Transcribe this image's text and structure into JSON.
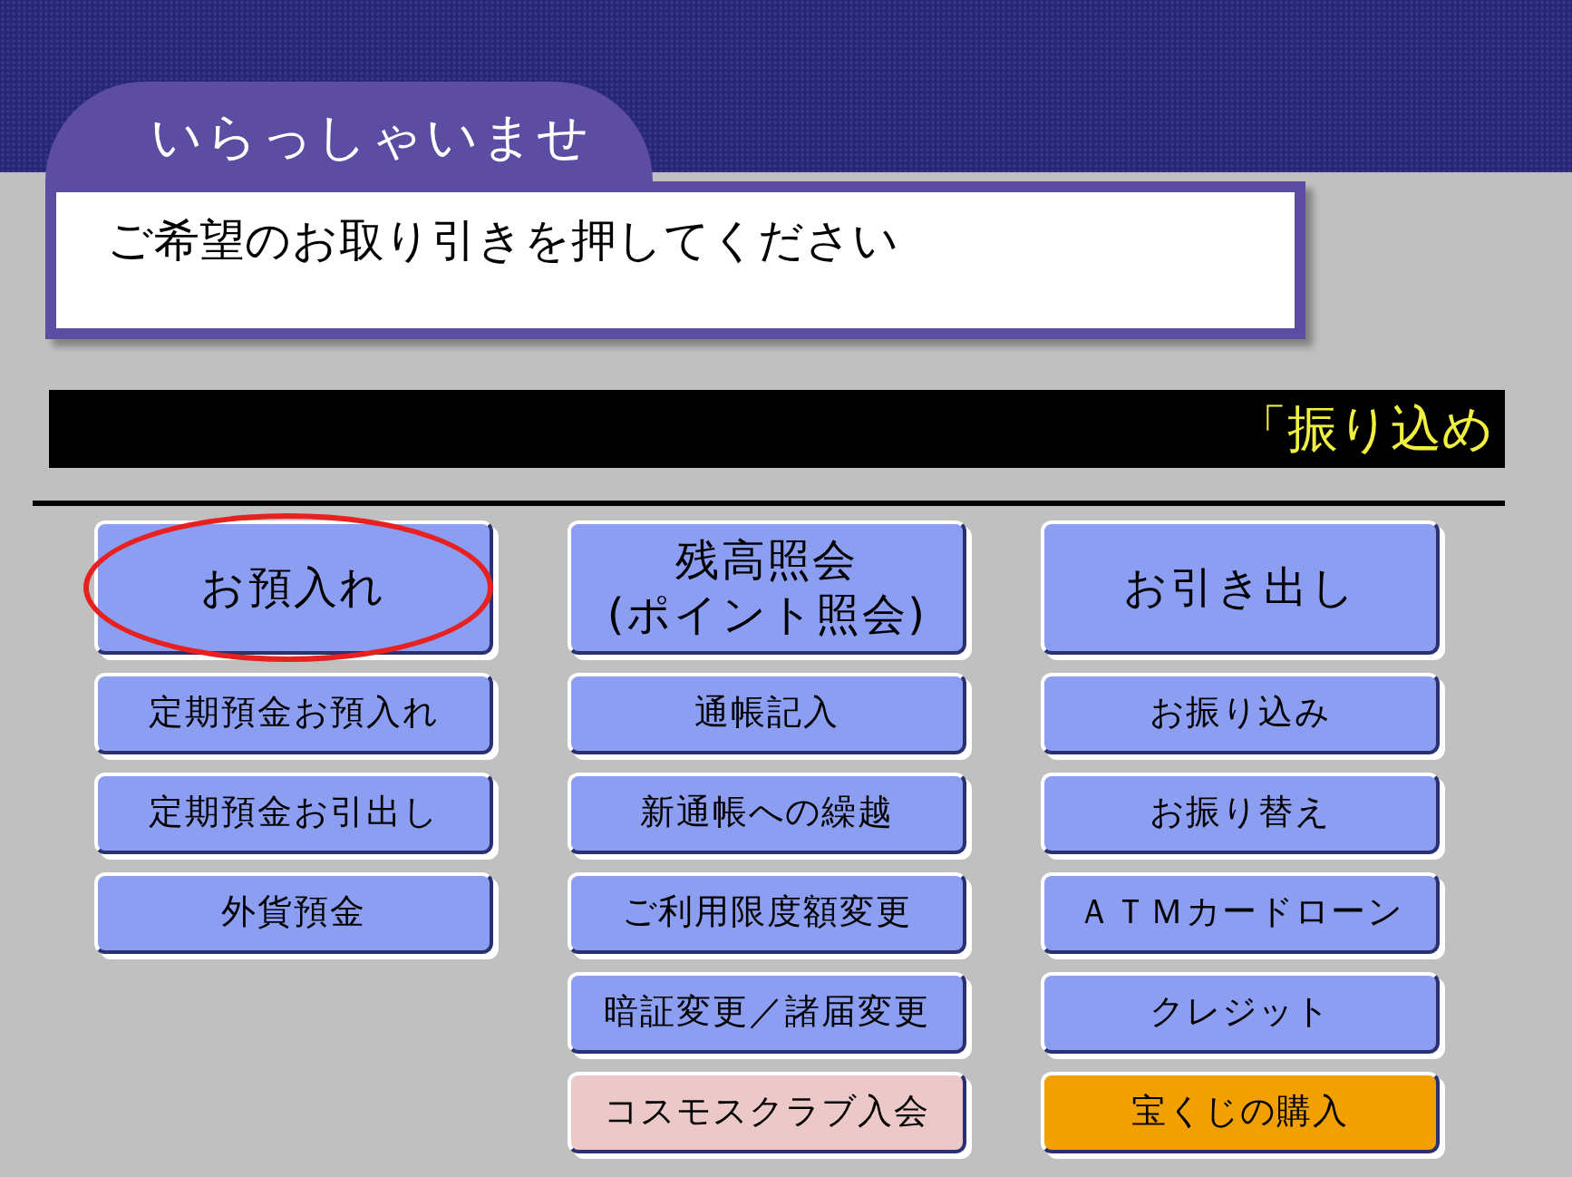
{
  "header": {
    "title": "いらっしゃいませ",
    "message": "ご希望のお取り引きを押してください"
  },
  "ticker": "「振り込め",
  "columns": [
    [
      {
        "label": "お預入れ",
        "kind": "large",
        "color": "#8c9ef2",
        "circled": true
      },
      {
        "label": "定期預金お預入れ",
        "kind": "small",
        "color": "#8c9ef2",
        "circled": false
      },
      {
        "label": "定期預金お引出し",
        "kind": "small",
        "color": "#8c9ef2",
        "circled": false
      },
      {
        "label": "外貨預金",
        "kind": "small",
        "color": "#8c9ef2",
        "circled": false
      }
    ],
    [
      {
        "label": "残高照会\n(ポイント照会)",
        "kind": "large",
        "color": "#8c9ef2",
        "circled": false
      },
      {
        "label": "通帳記入",
        "kind": "small",
        "color": "#8c9ef2",
        "circled": false
      },
      {
        "label": "新通帳への繰越",
        "kind": "small",
        "color": "#8c9ef2",
        "circled": false
      },
      {
        "label": "ご利用限度額変更",
        "kind": "small",
        "color": "#8c9ef2",
        "circled": false
      },
      {
        "label": "暗証変更／諸届変更",
        "kind": "small",
        "color": "#8c9ef2",
        "circled": false
      },
      {
        "label": "コスモスクラブ入会",
        "kind": "small",
        "color": "#ecc8c8",
        "circled": false
      }
    ],
    [
      {
        "label": "お引き出し",
        "kind": "large",
        "color": "#8c9ef2",
        "circled": false
      },
      {
        "label": "お振り込み",
        "kind": "small",
        "color": "#8c9ef2",
        "circled": false
      },
      {
        "label": "お振り替え",
        "kind": "small",
        "color": "#8c9ef2",
        "circled": false
      },
      {
        "label": "ＡＴＭカードローン",
        "kind": "small",
        "color": "#8c9ef2",
        "circled": false
      },
      {
        "label": "クレジット",
        "kind": "small",
        "color": "#8c9ef2",
        "circled": false
      },
      {
        "label": "宝くじの購入",
        "kind": "small",
        "color": "#f2a000",
        "circled": false
      }
    ]
  ]
}
